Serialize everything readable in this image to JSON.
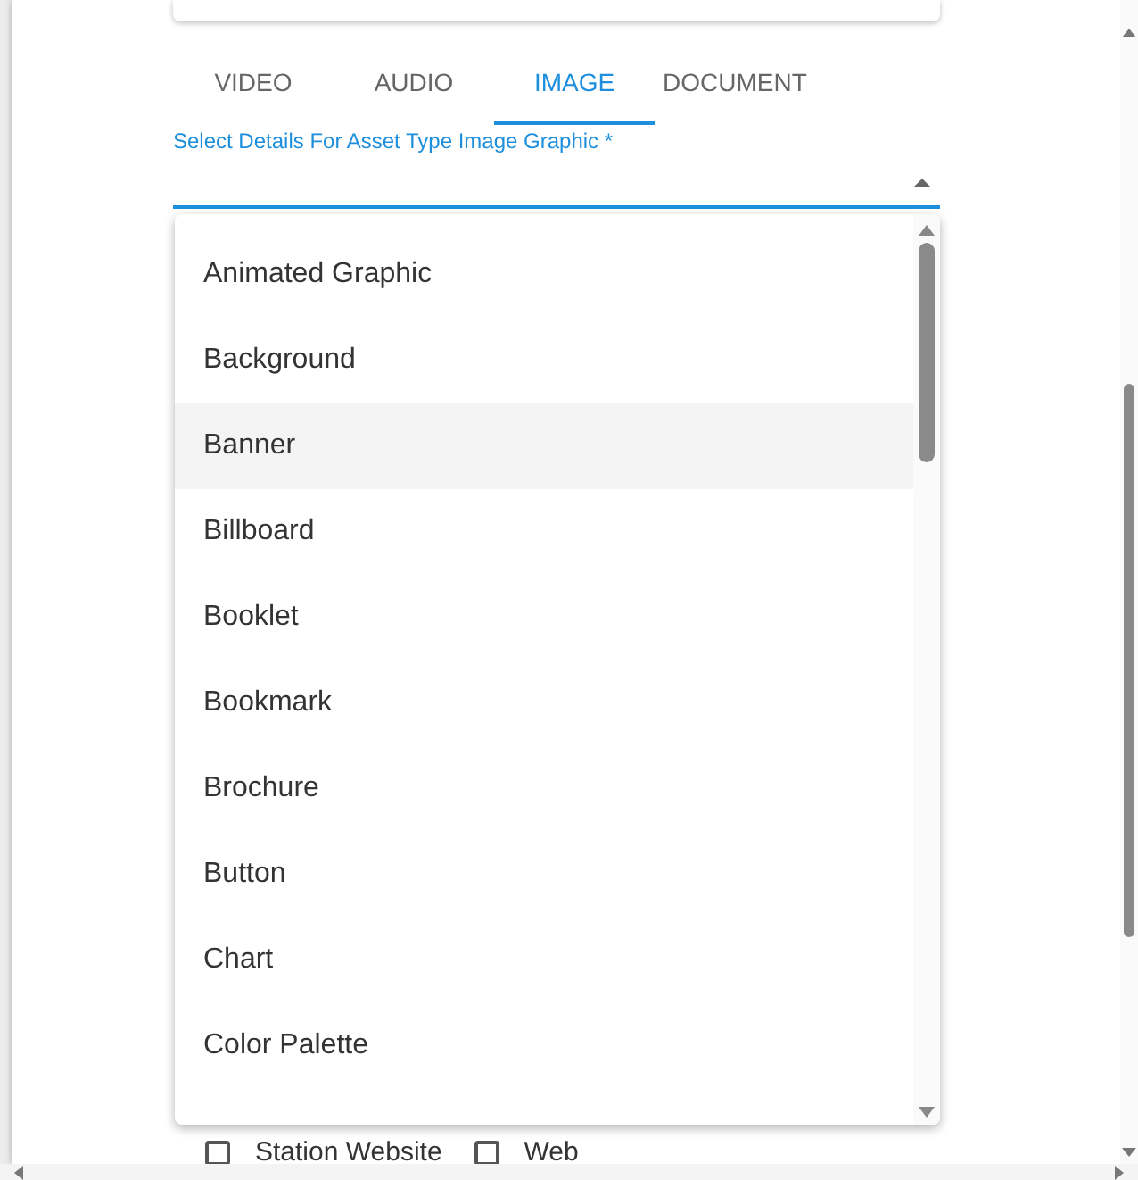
{
  "tabs": [
    {
      "label": "VIDEO",
      "selected": false
    },
    {
      "label": "AUDIO",
      "selected": false
    },
    {
      "label": "IMAGE",
      "selected": true
    },
    {
      "label": "DOCUMENT",
      "selected": false
    }
  ],
  "field": {
    "label": "Select Details For Asset Type Image Graphic *",
    "expanded": true
  },
  "options": [
    {
      "label": "Animated Graphic",
      "highlighted": false
    },
    {
      "label": "Background",
      "highlighted": false
    },
    {
      "label": "Banner",
      "highlighted": true
    },
    {
      "label": "Billboard",
      "highlighted": false
    },
    {
      "label": "Booklet",
      "highlighted": false
    },
    {
      "label": "Bookmark",
      "highlighted": false
    },
    {
      "label": "Brochure",
      "highlighted": false
    },
    {
      "label": "Button",
      "highlighted": false
    },
    {
      "label": "Chart",
      "highlighted": false
    },
    {
      "label": "Color Palette",
      "highlighted": false
    }
  ],
  "checkboxes": [
    {
      "label": "Station Website",
      "checked": false
    },
    {
      "label": "Web",
      "checked": false
    }
  ]
}
